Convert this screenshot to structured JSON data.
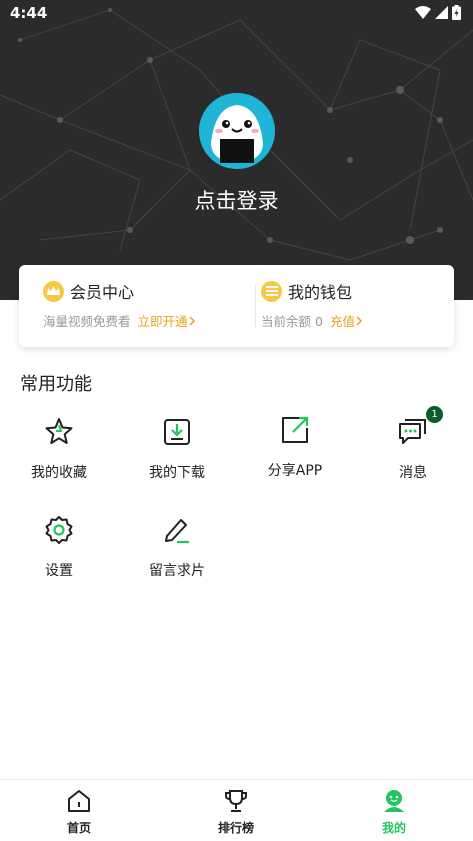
{
  "status_bar": {
    "time": "4:44"
  },
  "profile": {
    "login_text": "点击登录"
  },
  "member_card": {
    "vip": {
      "title": "会员中心",
      "subtitle": "海量视频免费看",
      "action": "立即开通"
    },
    "wallet": {
      "title": "我的钱包",
      "subtitle": "当前余额 0",
      "action": "充值"
    }
  },
  "functions": {
    "section_title": "常用功能",
    "items": [
      {
        "label": "我的收藏",
        "icon": "star-icon"
      },
      {
        "label": "我的下载",
        "icon": "download-icon"
      },
      {
        "label": "分享APP",
        "icon": "share-icon"
      },
      {
        "label": "消息",
        "icon": "message-icon",
        "badge": "1"
      },
      {
        "label": "设置",
        "icon": "gear-icon"
      },
      {
        "label": "留言求片",
        "icon": "edit-icon"
      }
    ]
  },
  "bottom_nav": {
    "items": [
      {
        "label": "首页",
        "icon": "home-icon"
      },
      {
        "label": "排行榜",
        "icon": "trophy-icon"
      },
      {
        "label": "我的",
        "icon": "profile-icon",
        "active": true
      }
    ]
  },
  "colors": {
    "accent_green": "#22c55e",
    "gold": "#e8a21b",
    "header_bg": "#2b2b2b"
  }
}
